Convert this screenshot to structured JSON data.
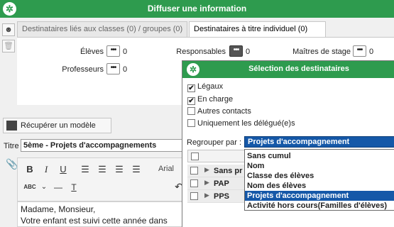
{
  "window": {
    "title": "Diffuser une information",
    "logo_glyph": "✲"
  },
  "tabs": [
    {
      "label": "Destinataires liés aux classes (0) / groupes (0)"
    },
    {
      "label": "Destinataires à titre individuel (0)"
    }
  ],
  "recipients": {
    "eleves": {
      "label": "Élèves",
      "count": "0"
    },
    "responsables": {
      "label": "Responsables",
      "count": "0"
    },
    "maitres": {
      "label": "Maîtres de stage",
      "count": "0"
    },
    "professeurs": {
      "label": "Professeurs",
      "count": "0"
    },
    "dots": "•••"
  },
  "model_button": {
    "label": "Récupérer un modèle"
  },
  "titre": {
    "label": "Titre",
    "value": "5ème - Projets d'accompagnements"
  },
  "toolbar": {
    "bold": "B",
    "italic": "I",
    "underline": "U",
    "font": "Arial",
    "spell": "ABC",
    "clear_format": "T"
  },
  "editor": {
    "line1": "Madame, Monsieur,",
    "line2": "Votre enfant est suivi cette année dans"
  },
  "dialog": {
    "title": "Sélection des destinataires",
    "checks": [
      {
        "label": "Légaux",
        "checked": "✔"
      },
      {
        "label": "En charge",
        "checked": "✔"
      },
      {
        "label": "Autres contacts",
        "checked": ""
      },
      {
        "label": "Uniquement les délégué(e)s",
        "checked": ""
      }
    ],
    "regroup_label": "Regrouper par :",
    "regroup_value": "Projets d'accompagnement",
    "rows": [
      {
        "label": "Sans pr"
      },
      {
        "label": "PAP"
      },
      {
        "label": "PPS"
      }
    ],
    "dropdown_options": [
      "Sans cumul",
      "Nom",
      "Classe des élèves",
      "Nom des élèves",
      "Projets d'accompagnement",
      "Activité hors cours(Familles d'élèves)"
    ]
  }
}
